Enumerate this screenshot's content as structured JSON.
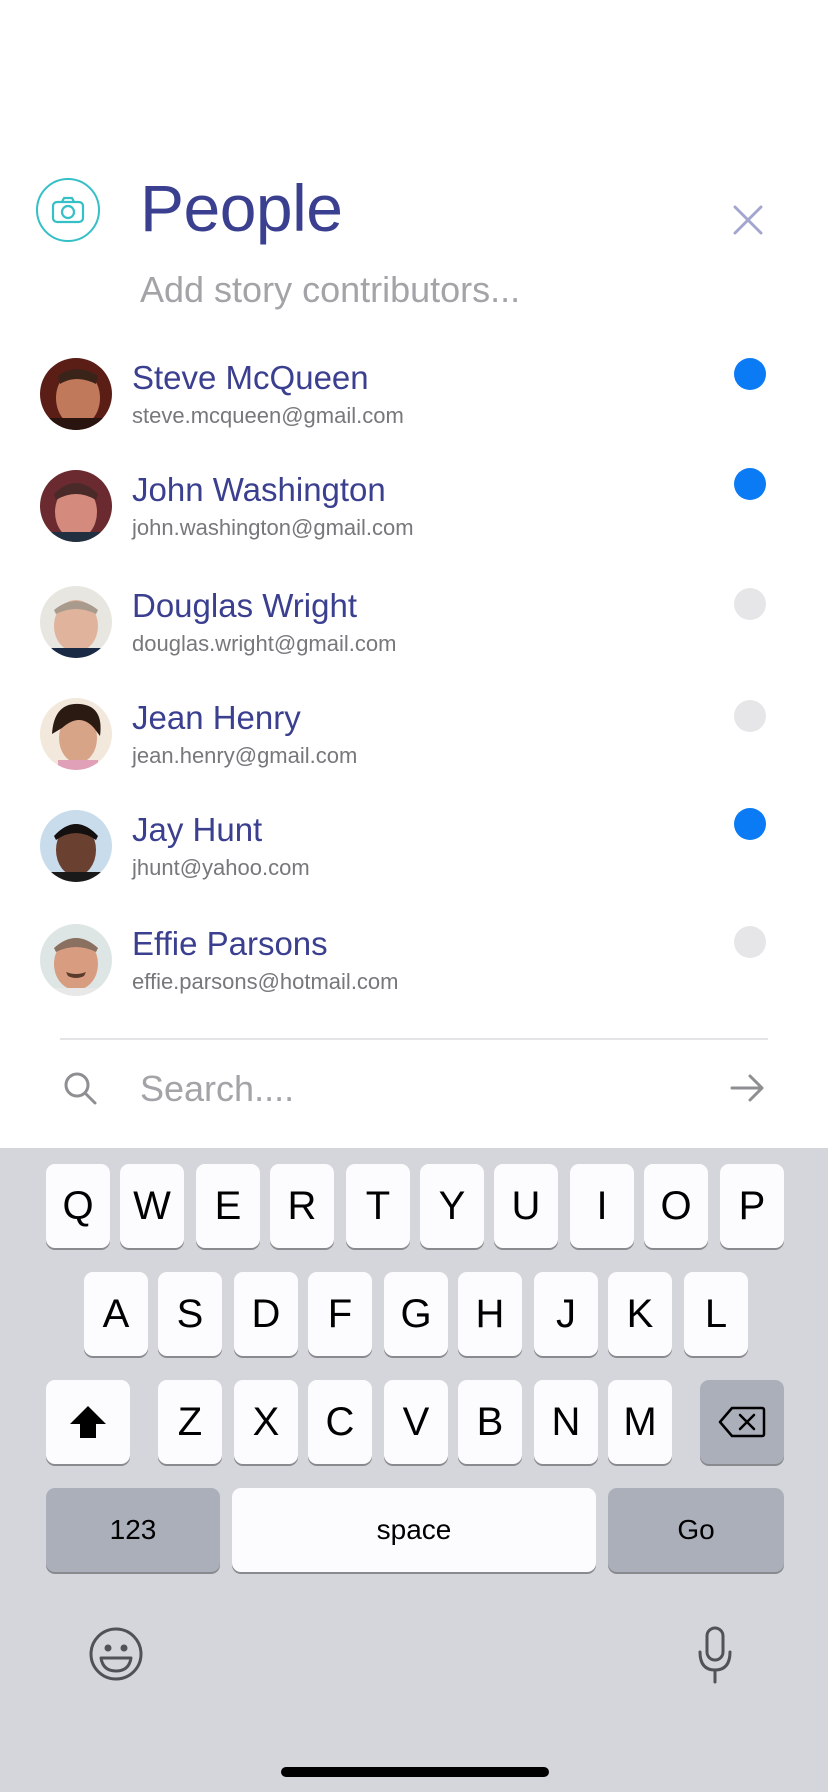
{
  "header": {
    "title": "People",
    "subtitle": "Add story contributors...",
    "camera_icon": "camera-icon",
    "close_icon": "close-icon",
    "accent_teal": "#35bfc6",
    "title_color": "#3b3f8f"
  },
  "people": [
    {
      "name": "Steve McQueen",
      "email": "steve.mcqueen@gmail.com",
      "selected": true
    },
    {
      "name": "John Washington",
      "email": "john.washington@gmail.com",
      "selected": true
    },
    {
      "name": "Douglas Wright",
      "email": "douglas.wright@gmail.com",
      "selected": false
    },
    {
      "name": "Jean Henry",
      "email": "jean.henry@gmail.com",
      "selected": false
    },
    {
      "name": "Jay Hunt",
      "email": "jhunt@yahoo.com",
      "selected": true
    },
    {
      "name": "Effie Parsons",
      "email": "effie.parsons@hotmail.com",
      "selected": false
    }
  ],
  "search": {
    "placeholder": "Search....",
    "value": "",
    "search_icon": "search-icon",
    "submit_icon": "arrow-right-icon"
  },
  "keyboard": {
    "row1": [
      "Q",
      "W",
      "E",
      "R",
      "T",
      "Y",
      "U",
      "I",
      "O",
      "P"
    ],
    "row2": [
      "A",
      "S",
      "D",
      "F",
      "G",
      "H",
      "J",
      "K",
      "L"
    ],
    "row3": [
      "Z",
      "X",
      "C",
      "V",
      "B",
      "N",
      "M"
    ],
    "numbers_label": "123",
    "space_label": "space",
    "go_label": "Go",
    "shift_icon": "shift-icon",
    "backspace_icon": "backspace-icon",
    "emoji_icon": "emoji-icon",
    "mic_icon": "microphone-icon"
  },
  "colors": {
    "selected": "#0a7bf5",
    "unselected": "#e6e6e8"
  }
}
